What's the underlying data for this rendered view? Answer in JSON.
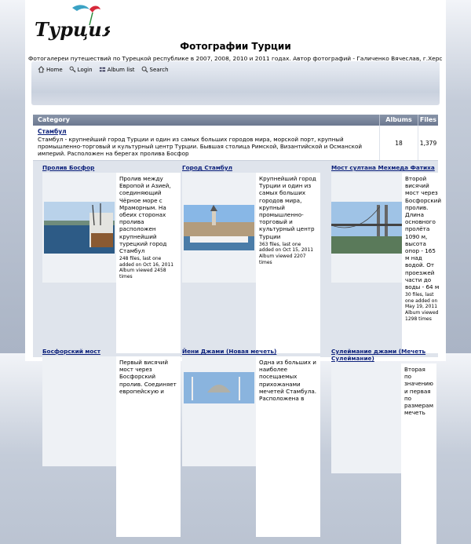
{
  "logo": {
    "text": "Турция"
  },
  "header": {
    "title": "Фотографии Турции",
    "description": "Фотогалереи путешествий по Турецкой республике в 2007, 2008, 2010 и 2011 годах. Автор фотографий - Галиченко Вячеслав, г.Херсон"
  },
  "menu": {
    "home": "Home",
    "login": "Login",
    "album_list": "Album list",
    "search": "Search"
  },
  "table": {
    "headers": {
      "category": "Category",
      "albums": "Albums",
      "files": "Files"
    }
  },
  "category": {
    "name": "Стамбул",
    "description": "Стамбул - крупнейший город Турции и один из самых больших городов мира, морской порт, крупный промышленно-торговый и культурный центр Турции. Бывшая столица Римской, Византийской и Османской империй. Расположен на берегах пролива Босфор",
    "albums": "18",
    "files": "1,379"
  },
  "albums": [
    {
      "title": "Пролив Босфор",
      "description": "Пролив между Европой и Азией, соединяющий Чёрное море с Мраморным. На обеих сторонах пролива расположен крупнейший турецкий город Стамбул",
      "info": "248 files, last one added on Oct 16, 2011 Album viewed 2458 times"
    },
    {
      "title": "Город Стамбул",
      "description": "Крупнейший город Турции и один из самых больших городов мира, крупный промышленно-торговый и культурный центр Турции",
      "info": "363 files, last one added on Oct 15, 2011 Album viewed 2207 times"
    },
    {
      "title": "Мост султана Мехмеда Фатиха",
      "description": "Второй висячий мост через Босфорский пролив. Длина основного пролёта 1090 м, высота опор - 165 м над водой. От проезжей части до воды - 64 м",
      "info": "30 files, last one added on May 19, 2011 Album viewed 1298 times"
    },
    {
      "title": "Босфорский мост",
      "description": "Первый висячий мост через Босфорский пролив. Соединяет европейскую и",
      "info": ""
    },
    {
      "title": "Йени Джами (Новая мечеть)",
      "description": "Одна из больших и наиболее посещаемых прихожанами мечетей Стамбула. Расположена в",
      "info": ""
    },
    {
      "title": "Сулеймание джами (Мечеть Сулеймание)",
      "description": "Вторая по значению и первая по размерам мечеть",
      "info": ""
    }
  ]
}
